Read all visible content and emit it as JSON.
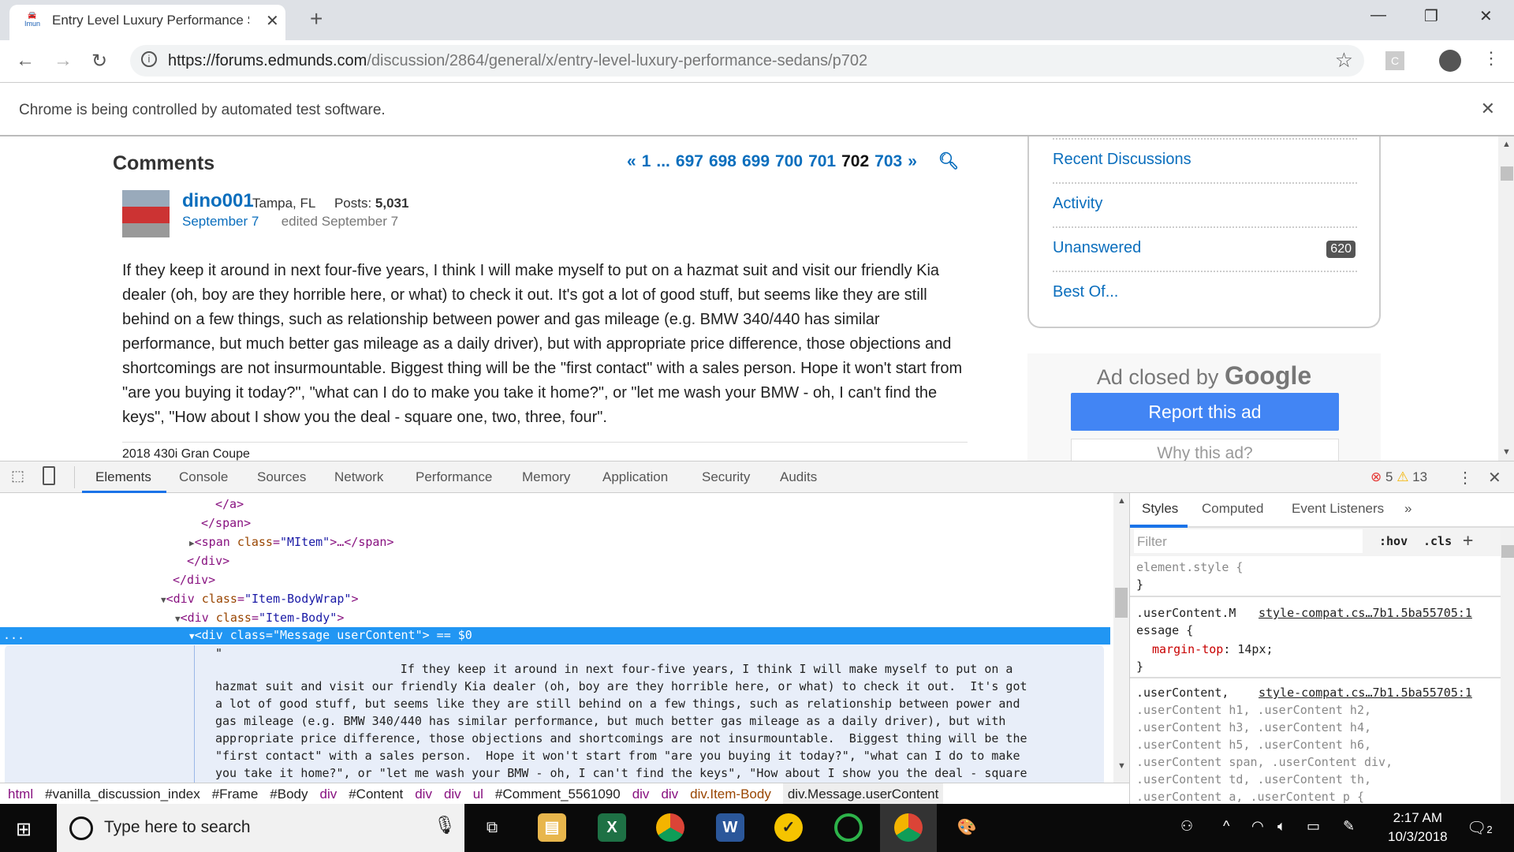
{
  "browser": {
    "tab_title": "Entry Level Luxury Performance Sedans",
    "tab_favicon_label": "Imun",
    "url_host": "https://forums.edmunds.com",
    "url_path": "/discussion/2864/general/x/entry-level-luxury-performance-sedans/p702",
    "infobar": "Chrome is being controlled by automated test software.",
    "extension_label": "C"
  },
  "page": {
    "heading": "Comments",
    "pagination": [
      "«",
      "1",
      "...",
      "697",
      "698",
      "699",
      "700",
      "701",
      "702",
      "703",
      "»"
    ],
    "current_page": "702",
    "comment": {
      "author": "dino001",
      "location": "Tampa, FL",
      "posts_label": "Posts:",
      "posts": "5,031",
      "date": "September 7",
      "edited": "edited September 7",
      "body": "If they keep it around in next four-five years, I think I will make myself to put on a hazmat suit and visit our friendly Kia dealer (oh, boy are they horrible here, or what) to check it out. It's got a lot of good stuff, but seems like they are still behind on a few things, such as relationship between power and gas mileage (e.g. BMW 340/440 has similar performance, but much better gas mileage as a daily driver), but with appropriate price difference, those objections and shortcomings are not insurmountable. Biggest thing will be the \"first contact\" with a sales person. Hope it won't start from \"are you buying it today?\", \"what can I do to make you take it home?\", or \"let me wash your BMW - oh, I can't find the keys\", \"How about I show you the deal - square one, two, three, four\".",
      "signature": "2018 430i Gran Coupe"
    },
    "sidebar": [
      {
        "label": "Recent Discussions"
      },
      {
        "label": "Activity"
      },
      {
        "label": "Unanswered",
        "count": "620"
      },
      {
        "label": "Best Of..."
      }
    ],
    "ad": {
      "closed_by": "Ad closed by",
      "brand": "Google",
      "report": "Report this ad",
      "why": "Why this ad?"
    }
  },
  "devtools": {
    "tabs": [
      "Elements",
      "Console",
      "Sources",
      "Network",
      "Performance",
      "Memory",
      "Application",
      "Security",
      "Audits"
    ],
    "active_tab": "Elements",
    "errors": "5",
    "warnings": "13",
    "tree": {
      "l1": "</a>",
      "l2": "</span>",
      "l3_tag": "<span ",
      "l3_attr": "class",
      "l3_val": "\"MItem\"",
      "l3_end": ">…</span>",
      "l4": "</div>",
      "l5": "</div>",
      "l6_tag": "<div ",
      "l6_attr": "class",
      "l6_val": "\"Item-BodyWrap\"",
      "l6_end": ">",
      "l7_tag": "<div ",
      "l7_attr": "class",
      "l7_val": "\"Item-Body\"",
      "l7_end": ">",
      "sel": "<div class=\"Message userContent\"> == $0",
      "quote": "\"",
      "text_lines": [
        "                          If they keep it around in next four-five years, I think I will make myself to put on a",
        "hazmat suit and visit our friendly Kia dealer (oh, boy are they horrible here, or what) to check it out.  It's got",
        "a lot of good stuff, but seems like they are still behind on a few things, such as relationship between power and",
        "gas mileage (e.g. BMW 340/440 has similar performance, but much better gas mileage as a daily driver), but with",
        "appropriate price difference, those objections and shortcomings are not insurmountable.  Biggest thing will be the",
        "\"first contact\" with a sales person.  Hope it won't start from \"are you buying it today?\", \"what can I do to make",
        "you take it home?\", or \"let me wash your BMW - oh, I can't find the keys\", \"How about I show you the deal - square"
      ]
    },
    "styles": {
      "tabs": [
        "Styles",
        "Computed",
        "Event Listeners",
        "»"
      ],
      "filter_placeholder": "Filter",
      "hov": ":hov",
      "cls": ".cls",
      "add": "+",
      "r1": "element.style {",
      "r1_close": "}",
      "r2_sel1": ".userContent.M",
      "r2_sel2": "essage {",
      "r2_src": "style-compat.cs…7b1.5ba55705:1",
      "r2_prop": "margin-top",
      "r2_val": ": 14px;",
      "r2_close": "}",
      "r3_sel": ".userContent,",
      "r3_src": "style-compat.cs…7b1.5ba55705:1",
      "r3_lines": [
        ".userContent h1, .userContent h2,",
        ".userContent h3, .userContent h4,",
        ".userContent h5, .userContent h6,",
        ".userContent span, .userContent div,",
        ".userContent td, .userContent th,",
        ".userContent a, .userContent p {"
      ]
    },
    "breadcrumbs": [
      "html",
      "#vanilla_discussion_index",
      "#Frame",
      "#Body",
      "div",
      "#Content",
      "div",
      "div",
      "ul",
      "#Comment_5561090",
      "div",
      "div",
      "div.Item-Body",
      "div.Message.userContent"
    ]
  },
  "taskbar": {
    "search_placeholder": "Type here to search",
    "time": "2:17 AM",
    "date": "10/3/2018",
    "notifications": "2"
  }
}
